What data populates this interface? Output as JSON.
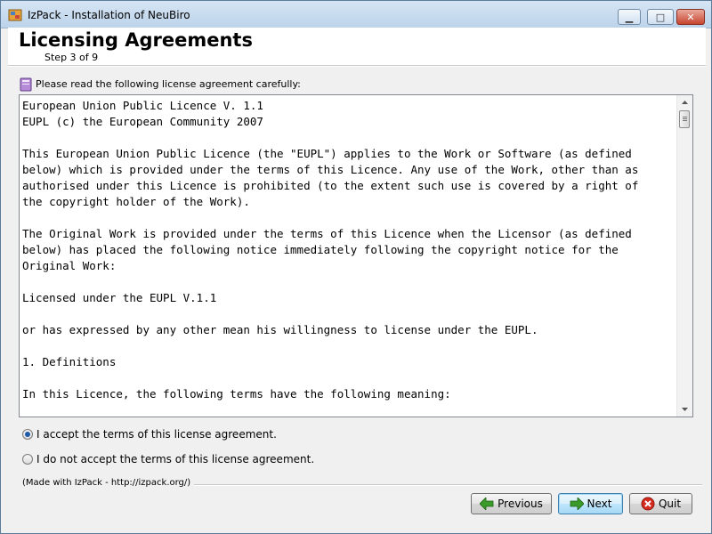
{
  "window": {
    "title": "IzPack - Installation of NeuBiro",
    "controls": {
      "minimize": "▁",
      "maximize": "□",
      "close": "✕"
    }
  },
  "header": {
    "title": "Licensing Agreements",
    "step": "Step 3 of 9"
  },
  "panel": {
    "prompt": "Please read the following license agreement carefully:",
    "license_text": "European Union Public Licence V. 1.1\nEUPL (c) the European Community 2007\n\nThis European Union Public Licence (the \"EUPL\") applies to the Work or Software (as defined\nbelow) which is provided under the terms of this Licence. Any use of the Work, other than as\nauthorised under this Licence is prohibited (to the extent such use is covered by a right of\nthe copyright holder of the Work).\n\nThe Original Work is provided under the terms of this Licence when the Licensor (as defined\nbelow) has placed the following notice immediately following the copyright notice for the\nOriginal Work:\n\nLicensed under the EUPL V.1.1\n\nor has expressed by any other mean his willingness to license under the EUPL.\n\n1. Definitions\n\nIn this Licence, the following terms have the following meaning:",
    "accept_label": "I accept the terms of this license agreement.",
    "decline_label": "I do not accept the terms of this license agreement.",
    "selected": "accept"
  },
  "footer": {
    "made_with": "(Made with IzPack - http://izpack.org/)",
    "previous_label": "Previous",
    "next_label": "Next",
    "quit_label": "Quit"
  },
  "colors": {
    "previous_arrow": "#3a9a2a",
    "next_arrow": "#3a9a2a",
    "quit_icon": "#d62a1e"
  }
}
